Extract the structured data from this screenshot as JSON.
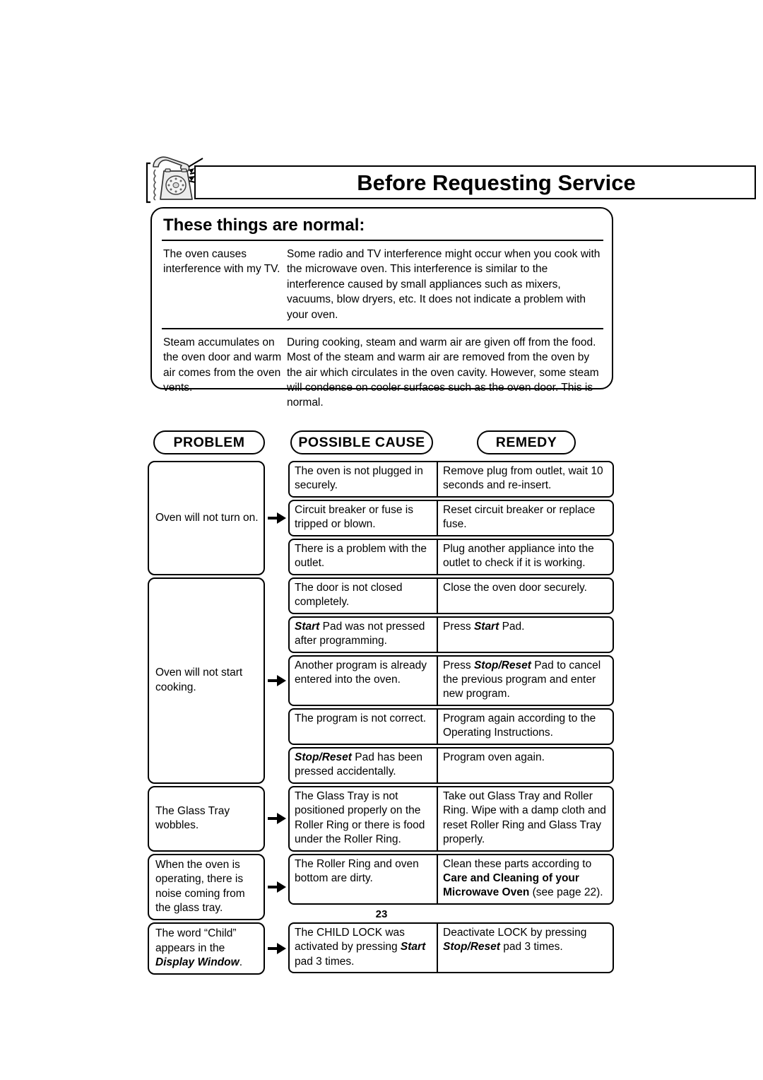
{
  "header": {
    "title": "Before Requesting Service",
    "icon": "telephone-icon"
  },
  "normal_section": {
    "title": "These things are normal:",
    "rows": [
      {
        "symptom": "The oven causes interference with my TV.",
        "explanation": "Some radio and TV interference might occur when you cook with the microwave oven. This interference is similar to the interference caused by small appliances such as mixers, vacuums, blow dryers, etc. It does not indicate a problem with your oven."
      },
      {
        "symptom": "Steam accumulates on the oven door and warm air comes from the oven vents.",
        "explanation": "During cooking, steam and warm air are given off from the food. Most of the steam and warm air are removed from the oven by the air which circulates in the oven cavity. However, some steam will condense on cooler surfaces such as the oven door. This is normal."
      }
    ]
  },
  "column_headers": {
    "problem": "PROBLEM",
    "possible_cause": "POSSIBLE CAUSE",
    "remedy": "REMEDY"
  },
  "troubleshooting": [
    {
      "problem": "Oven will not turn on.",
      "rows": [
        {
          "cause": "The oven is not plugged in securely.",
          "remedy": "Remove plug from outlet, wait 10 seconds and re-insert."
        },
        {
          "cause": "Circuit breaker or fuse is tripped or blown.",
          "remedy": "Reset circuit breaker or replace fuse."
        },
        {
          "cause": "There is a problem with the outlet.",
          "remedy": "Plug another appliance into the outlet to check if it is working."
        }
      ]
    },
    {
      "problem": "Oven will not start cooking.",
      "rows": [
        {
          "cause": "The door is not closed completely.",
          "remedy": "Close the oven door securely."
        },
        {
          "cause_html": "<b class=\"bi\">Start</b> Pad was not pressed after programming.",
          "remedy_html": "Press <b class=\"bi\">Start</b> Pad."
        },
        {
          "cause": "Another program is already entered into the oven.",
          "remedy_html": "Press <b class=\"bi\">Stop/Reset</b> Pad to cancel the previous program and enter new program."
        },
        {
          "cause": "The program is not correct.",
          "remedy": "Program again according to the Operating Instructions."
        },
        {
          "cause_html": "<b class=\"bi\">Stop/Reset</b> Pad has been pressed accidentally.",
          "remedy": "Program oven again."
        }
      ]
    },
    {
      "problem": "The Glass Tray wobbles.",
      "rows": [
        {
          "cause": "The Glass Tray is not positioned properly on the Roller Ring or there is food under the Roller Ring.",
          "remedy": "Take out Glass Tray and Roller Ring. Wipe with a damp cloth and reset Roller Ring and Glass Tray properly."
        }
      ]
    },
    {
      "problem": "When the oven is operating, there is noise coming from the glass tray.",
      "rows": [
        {
          "cause": "The Roller Ring and oven bottom are dirty.",
          "remedy_html": "Clean these parts according to <b class=\"bo\">Care and Cleaning of your Microwave Oven</b> (see page 22)."
        }
      ]
    },
    {
      "problem_html": "The word “Child” appears in the <b class=\"bi\">Display Window</b>.",
      "rows": [
        {
          "cause_html": "The CHILD LOCK was activated by pressing <b class=\"bi\">Start</b> pad 3 times.",
          "remedy_html": "Deactivate LOCK by pressing <b class=\"bi\">Stop/Reset</b> pad 3 times."
        }
      ]
    }
  ],
  "footer": {
    "page_number": "23"
  }
}
